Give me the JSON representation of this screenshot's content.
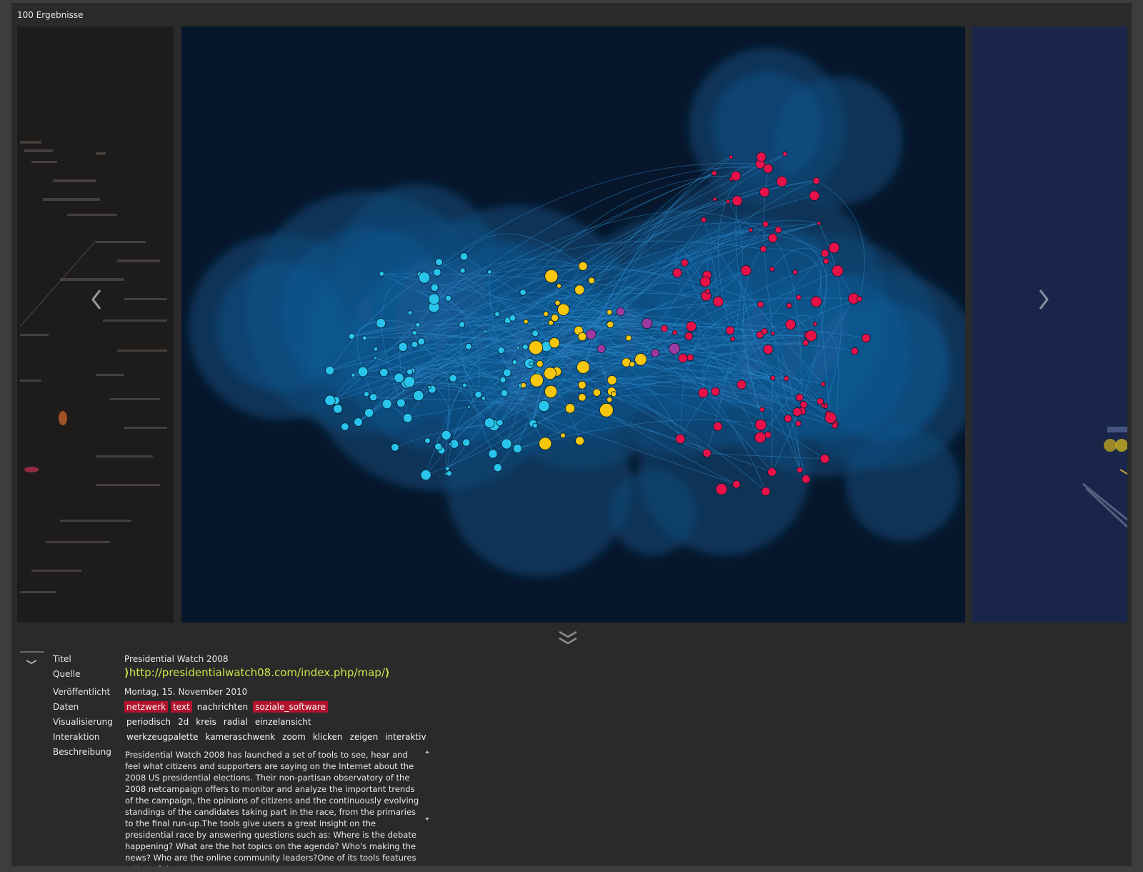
{
  "results": {
    "count_text": "100 Ergebnisse"
  },
  "details": {
    "title_label": "Titel",
    "title_value": "Presidential Watch 2008",
    "source_label": "Quelle",
    "source_value": "http://presidentialwatch08.com/index.php/map/",
    "published_label": "Veröffentlicht",
    "published_value": "Montag, 15. November 2010",
    "data_label": "Daten",
    "data_tags": [
      {
        "text": "netzwerk",
        "highlighted": true
      },
      {
        "text": "text",
        "highlighted": true
      },
      {
        "text": "nachrichten",
        "highlighted": false
      },
      {
        "text": "soziale_software",
        "highlighted": true
      }
    ],
    "visualization_label": "Visualisierung",
    "visualization_tags": [
      "periodisch",
      "2d",
      "kreis",
      "radial",
      "einzelansicht"
    ],
    "interaction_label": "Interaktion",
    "interaction_tags": [
      "werkzeugpalette",
      "kameraschwenk",
      "zoom",
      "klicken",
      "zeigen",
      "interaktiv"
    ],
    "description_label": "Beschreibung",
    "description_text": "Presidential Watch 2008 has launched a set of tools to see, hear and feel what citizens and supporters are saying on the Internet about the 2008 US presidential elections. Their non-partisan observatory of the 2008 netcampaign offers to monitor and analyze the important trends of the campaign, the opinions of citizens and the continuously evolving standings of the candidates taking part in the race, from the primaries to the final run-up.The tools give users a great insight on the presidential race by answering questions such as: Where is the debate happening? What are the hot topics on the agenda? Who's making the news? Who are the online community leaders?One of its tools features a Map of the"
  },
  "icons": {
    "prev": "chevron-left-icon",
    "next": "chevron-right-icon",
    "collapse": "double-chevron-down-icon",
    "toggle": "chevron-down-icon",
    "scroll_up": "triangle-up-icon",
    "scroll_down": "triangle-down-icon"
  },
  "colors": {
    "accent_link": "#d2e34a",
    "tag_highlight": "#b3122e",
    "node_blue": "#29c4ec",
    "node_yellow": "#f6c70c",
    "node_red": "#e8124a",
    "node_purple": "#9b3aa0"
  }
}
